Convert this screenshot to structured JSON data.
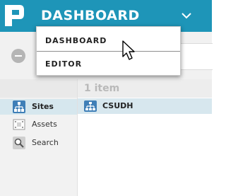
{
  "header": {
    "app_title": "DASHBOARD",
    "brand_color": "#1e95b8"
  },
  "dropdown": {
    "items": [
      {
        "label": "Dashboard"
      },
      {
        "label": "Editor"
      }
    ]
  },
  "sidebar": {
    "items": [
      {
        "label": "Sites",
        "icon": "sitemap-icon",
        "active": true
      },
      {
        "label": "Assets",
        "icon": "assets-icon",
        "active": false
      },
      {
        "label": "Search",
        "icon": "search-icon",
        "active": false
      }
    ]
  },
  "list": {
    "count_label": "1 item",
    "rows": [
      {
        "label": "CSUDH",
        "icon": "sitemap-icon"
      }
    ]
  }
}
